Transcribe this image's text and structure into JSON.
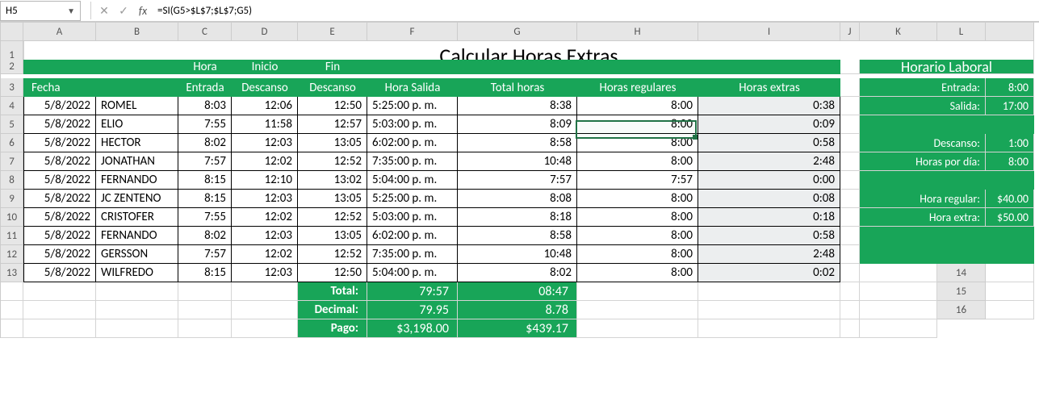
{
  "formula_bar": {
    "cell_ref": "H5",
    "formula": "=SI(G5>$L$7;$L$7;G5)"
  },
  "columns": [
    "",
    "A",
    "B",
    "C",
    "D",
    "E",
    "F",
    "G",
    "H",
    "I",
    "J",
    "K",
    "L",
    ""
  ],
  "row_nums": [
    "1",
    "2",
    "3",
    "4",
    "5",
    "6",
    "7",
    "8",
    "9",
    "10",
    "11",
    "12",
    "13",
    "14",
    "15",
    "16"
  ],
  "title": "Calcular Horas Extras",
  "headers_top": [
    "",
    "Hora",
    "Inicio",
    "Fin",
    "",
    "",
    "",
    ""
  ],
  "headers_bot": [
    "Fecha",
    "Entrada",
    "Descanso",
    "Descanso",
    "Hora Salida",
    "Total horas",
    "Horas regulares",
    "Horas extras"
  ],
  "rows": [
    {
      "fecha": "5/8/2022",
      "nombre": "ROMEL",
      "ent": "8:03",
      "ini": "12:06",
      "fin": "12:50",
      "sal": "5:25:00 p. m.",
      "tot": "8:38",
      "reg": "8:00",
      "ext": "0:38"
    },
    {
      "fecha": "5/8/2022",
      "nombre": "ELIO",
      "ent": "7:55",
      "ini": "11:58",
      "fin": "12:57",
      "sal": "5:03:00 p. m.",
      "tot": "8:09",
      "reg": "8:00",
      "ext": "0:09"
    },
    {
      "fecha": "5/8/2022",
      "nombre": "HECTOR",
      "ent": "8:02",
      "ini": "12:03",
      "fin": "13:05",
      "sal": "6:02:00 p. m.",
      "tot": "8:58",
      "reg": "8:00",
      "ext": "0:58"
    },
    {
      "fecha": "5/8/2022",
      "nombre": "JONATHAN",
      "ent": "7:57",
      "ini": "12:02",
      "fin": "12:52",
      "sal": "7:35:00 p. m.",
      "tot": "10:48",
      "reg": "8:00",
      "ext": "2:48"
    },
    {
      "fecha": "5/8/2022",
      "nombre": "FERNANDO",
      "ent": "8:15",
      "ini": "12:10",
      "fin": "13:02",
      "sal": "5:04:00 p. m.",
      "tot": "7:57",
      "reg": "7:57",
      "ext": "0:00"
    },
    {
      "fecha": "5/8/2022",
      "nombre": "JC ZENTENO",
      "ent": "8:15",
      "ini": "12:03",
      "fin": "13:05",
      "sal": "5:25:00 p. m.",
      "tot": "8:08",
      "reg": "8:00",
      "ext": "0:08"
    },
    {
      "fecha": "5/8/2022",
      "nombre": "CRISTOFER",
      "ent": "7:55",
      "ini": "12:02",
      "fin": "12:52",
      "sal": "5:03:00 p. m.",
      "tot": "8:18",
      "reg": "8:00",
      "ext": "0:18"
    },
    {
      "fecha": "5/8/2022",
      "nombre": "FERNANDO",
      "ent": "8:02",
      "ini": "12:03",
      "fin": "13:05",
      "sal": "6:02:00 p. m.",
      "tot": "8:58",
      "reg": "8:00",
      "ext": "0:58"
    },
    {
      "fecha": "5/8/2022",
      "nombre": "GERSSON",
      "ent": "7:57",
      "ini": "12:02",
      "fin": "12:52",
      "sal": "7:35:00 p. m.",
      "tot": "10:48",
      "reg": "8:00",
      "ext": "2:48"
    },
    {
      "fecha": "5/8/2022",
      "nombre": "WILFREDO",
      "ent": "8:15",
      "ini": "12:03",
      "fin": "12:50",
      "sal": "5:04:00 p. m.",
      "tot": "8:02",
      "reg": "8:00",
      "ext": "0:02"
    }
  ],
  "summary": {
    "total_label": "Total:",
    "total_reg": "79:57",
    "total_ext": "08:47",
    "dec_label": "Decimal:",
    "dec_reg": "79.95",
    "dec_ext": "8.78",
    "pay_label": "Pago:",
    "pay_reg": "$3,198.00",
    "pay_ext": "$439.17"
  },
  "side": {
    "title": "Horario Laboral",
    "entrada_l": "Entrada:",
    "entrada_v": "8:00",
    "salida_l": "Salida:",
    "salida_v": "17:00",
    "desc_l": "Descanso:",
    "desc_v": "1:00",
    "hpd_l": "Horas por día:",
    "hpd_v": "8:00",
    "hreg_l": "Hora regular:",
    "hreg_v": "$40.00",
    "hext_l": "Hora extra:",
    "hext_v": "$50.00"
  }
}
